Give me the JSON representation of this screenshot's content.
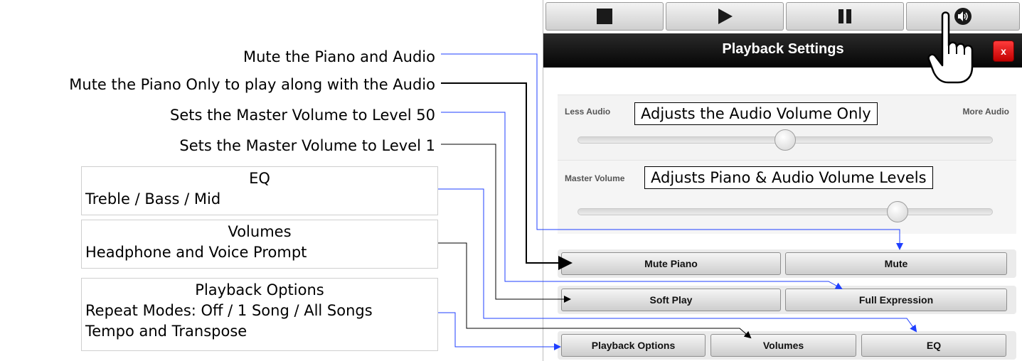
{
  "annotations": {
    "mute_all": "Mute the Piano and Audio",
    "mute_piano": "Mute the Piano Only to play along with the Audio",
    "master50": "Sets the Master Volume to Level 50",
    "master1": "Sets the Master Volume to Level 1",
    "eq_title": "EQ",
    "eq_desc": "Treble / Bass / Mid",
    "vol_title": "Volumes",
    "vol_desc": "Headphone and Voice Prompt",
    "po_title": "Playback Options",
    "po_desc1": "Repeat Modes: Off / 1 Song / All Songs",
    "po_desc2": "Tempo and Transpose",
    "audio_callout": "Adjusts the Audio Volume Only",
    "master_callout": "Adjusts Piano & Audio Volume Levels"
  },
  "transport": {
    "buttons": [
      "stop-icon",
      "play-icon",
      "pause-icon",
      "speaker-icon"
    ]
  },
  "dialog": {
    "title": "Playback Settings",
    "close_label": "x",
    "less_audio": "Less Audio",
    "more_audio": "More Audio",
    "master_volume_label": "Master Volume",
    "audio_slider_value": 0.5,
    "master_slider_value": 0.77,
    "buttons": {
      "mute_piano": "Mute Piano",
      "mute": "Mute",
      "soft_play": "Soft Play",
      "full_expression": "Full Expression",
      "playback_options": "Playback Options",
      "volumes": "Volumes",
      "eq": "EQ"
    }
  },
  "colors": {
    "accent_line": "#1f3fff",
    "close": "#d40000"
  }
}
